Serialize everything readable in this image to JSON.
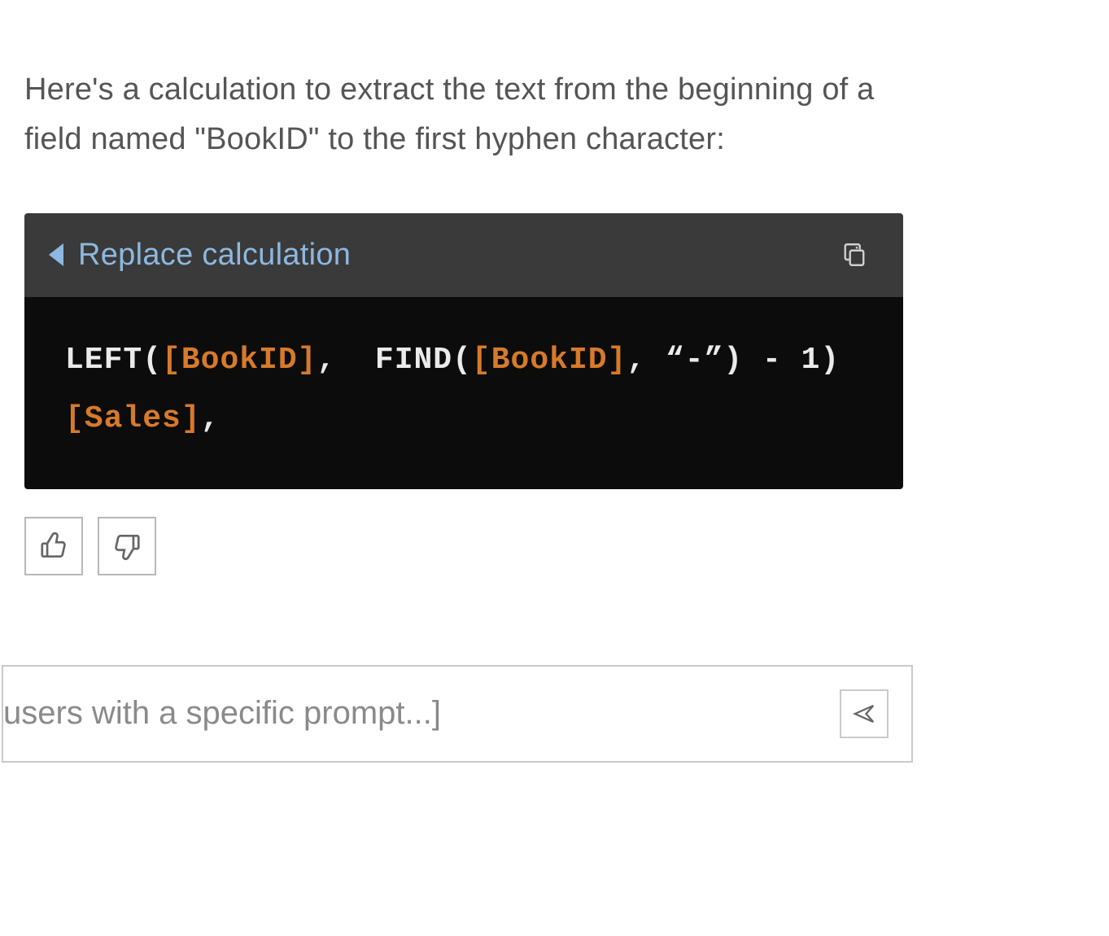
{
  "message": {
    "intro_text": "Here's a calculation to extract the text from the beginning of a field named \"BookID\" to the first hyphen character:"
  },
  "code_block": {
    "header": {
      "replace_label": "Replace calculation"
    },
    "tokens": {
      "fn_left": "LEFT",
      "open_paren1": "(",
      "fld_bookid1": "[BookID]",
      "comma1": ",  ",
      "fn_find": "FIND",
      "open_paren2": "(",
      "fld_bookid2": "[BookID]",
      "comma2": ", ",
      "hyphen_str_open": "“",
      "hyphen": "-",
      "hyphen_str_close": "”)",
      "space_minus": " - ",
      "one_close": "1)",
      "fld_sales": "[Sales]",
      "comma3": ","
    }
  },
  "input": {
    "placeholder": "users with a specific prompt...]",
    "value": ""
  }
}
